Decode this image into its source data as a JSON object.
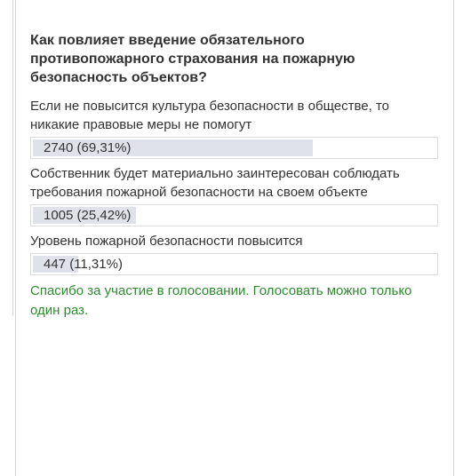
{
  "poll": {
    "question": "Как повлияет введение обязательного противопожарного страхования на пожарную безопасность объектов?",
    "options": [
      {
        "label": "Если не повысится культура безопасности в обществе, то никакие правовые меры не помогут",
        "result_text": "2740 (69,31%)",
        "votes": 2740,
        "percent": 69.31
      },
      {
        "label": "Собственник будет материально заинтересован соблюдать требования пожарной безопасности на своем объекте",
        "result_text": "1005 (25,42%)",
        "votes": 1005,
        "percent": 25.42
      },
      {
        "label": "Уровень пожарной безопасности повысится",
        "result_text": "447 (11,31%)",
        "votes": 447,
        "percent": 11.31
      }
    ],
    "thanks_message": "Спасибо за участие в голосовании. Голосовать можно только один раз.",
    "colors": {
      "bar": "#e0e2ea",
      "thanks": "#2f8a2f",
      "text": "#333333"
    }
  }
}
